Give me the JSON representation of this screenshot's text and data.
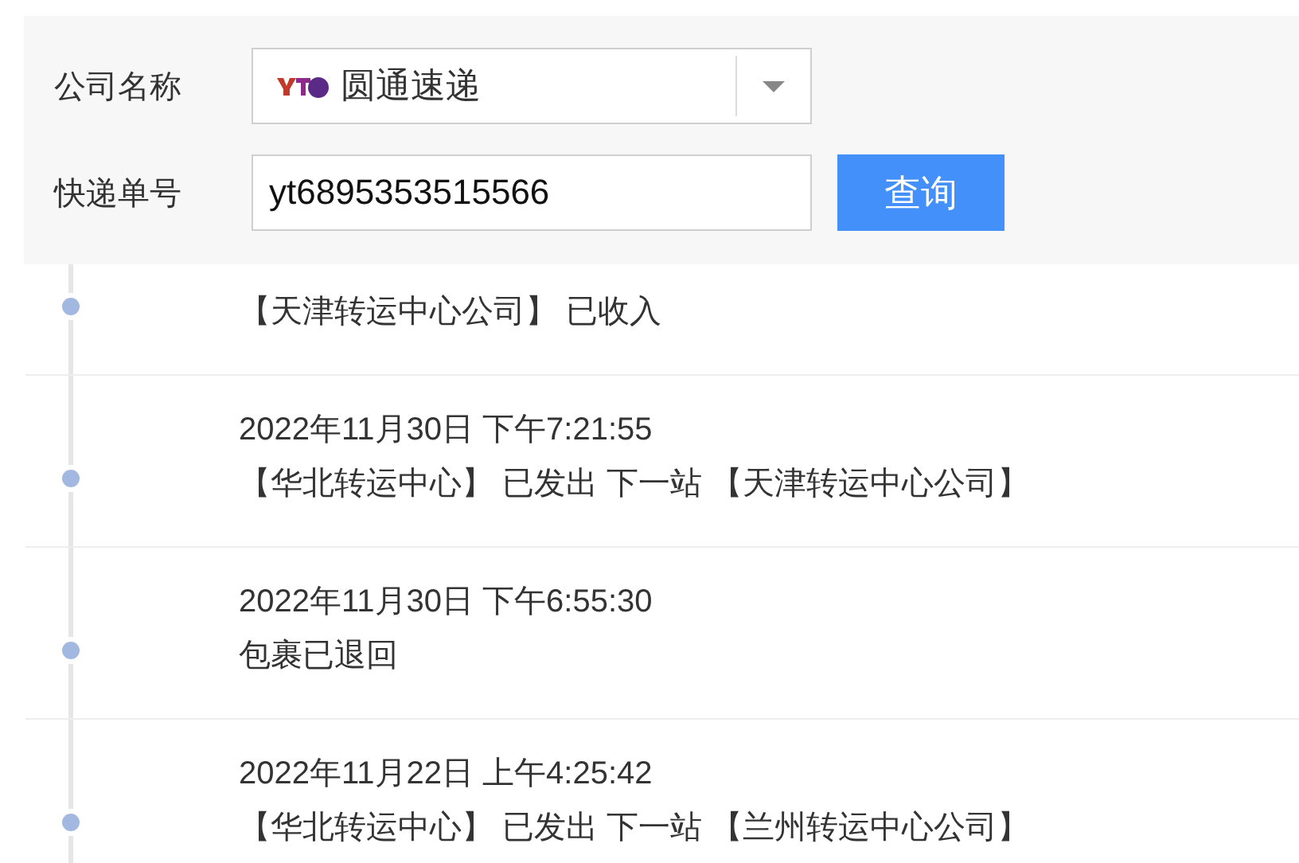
{
  "query_form": {
    "company": {
      "label": "公司名称",
      "value": "圆通速递"
    },
    "tracking_number": {
      "label": "快递单号",
      "value": "yt6895353515566"
    },
    "submit_button": "查询"
  },
  "events": [
    {
      "description": "【天津转运中心公司】 已收入"
    },
    {
      "time": "2022年11月30日 下午7:21:55",
      "description": "【华北转运中心】 已发出 下一站 【天津转运中心公司】"
    },
    {
      "time": "2022年11月30日 下午6:55:30",
      "description": "包裹已退回"
    },
    {
      "time": "2022年11月22日 上午4:25:42",
      "description": "【华北转运中心】 已发出 下一站 【兰州转运中心公司】"
    }
  ]
}
